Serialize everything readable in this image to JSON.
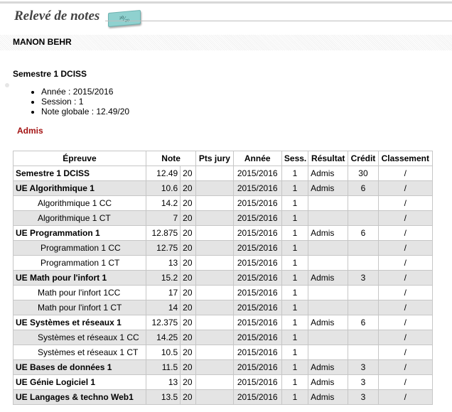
{
  "header": {
    "title": "Relevé de notes",
    "badge": "²⁰⁄₂₀"
  },
  "student": {
    "name": "MANON BEHR"
  },
  "semester": {
    "title": "Semestre 1 DCISS"
  },
  "info": [
    "Année : 2015/2016",
    "Session : 1",
    "Note globale : 12.49/20"
  ],
  "status": "Admis",
  "table": {
    "headers": [
      "Épreuve",
      "Note",
      "Pts jury",
      "Année",
      "Sess.",
      "Résultat",
      "Crédit",
      "Classement"
    ],
    "rows": [
      {
        "kind": "ue",
        "epreuve": "Semestre 1 DCISS",
        "note": "12.49",
        "sur": "20",
        "pts": "",
        "annee": "2015/2016",
        "sess": "1",
        "resultat": "Admis",
        "credit": "30",
        "classement": "/"
      },
      {
        "kind": "ue",
        "epreuve": "UE Algorithmique 1",
        "note": "10.6",
        "sur": "20",
        "pts": "",
        "annee": "2015/2016",
        "sess": "1",
        "resultat": "Admis",
        "credit": "6",
        "classement": "/"
      },
      {
        "kind": "sub",
        "epreuve": "Algorithmique 1 CC",
        "note": "14.2",
        "sur": "20",
        "pts": "",
        "annee": "2015/2016",
        "sess": "1",
        "resultat": "",
        "credit": "",
        "classement": "/"
      },
      {
        "kind": "sub",
        "epreuve": "Algorithmique 1 CT",
        "note": "7",
        "sur": "20",
        "pts": "",
        "annee": "2015/2016",
        "sess": "1",
        "resultat": "",
        "credit": "",
        "classement": "/"
      },
      {
        "kind": "ue",
        "epreuve": "UE Programmation 1",
        "note": "12.875",
        "sur": "20",
        "pts": "",
        "annee": "2015/2016",
        "sess": "1",
        "resultat": "Admis",
        "credit": "6",
        "classement": "/"
      },
      {
        "kind": "sub2",
        "epreuve": "Programmation 1 CC",
        "note": "12.75",
        "sur": "20",
        "pts": "",
        "annee": "2015/2016",
        "sess": "1",
        "resultat": "",
        "credit": "",
        "classement": "/"
      },
      {
        "kind": "sub2",
        "epreuve": "Programmation 1 CT",
        "note": "13",
        "sur": "20",
        "pts": "",
        "annee": "2015/2016",
        "sess": "1",
        "resultat": "",
        "credit": "",
        "classement": "/"
      },
      {
        "kind": "ue",
        "epreuve": "UE Math pour l'infort 1",
        "note": "15.2",
        "sur": "20",
        "pts": "",
        "annee": "2015/2016",
        "sess": "1",
        "resultat": "Admis",
        "credit": "3",
        "classement": "/"
      },
      {
        "kind": "sub",
        "epreuve": "Math pour l'infort 1CC",
        "note": "17",
        "sur": "20",
        "pts": "",
        "annee": "2015/2016",
        "sess": "1",
        "resultat": "",
        "credit": "",
        "classement": "/"
      },
      {
        "kind": "sub",
        "epreuve": "Math pour l'infort 1 CT",
        "note": "14",
        "sur": "20",
        "pts": "",
        "annee": "2015/2016",
        "sess": "1",
        "resultat": "",
        "credit": "",
        "classement": "/"
      },
      {
        "kind": "ue",
        "epreuve": "UE Systèmes et réseaux 1",
        "note": "12.375",
        "sur": "20",
        "pts": "",
        "annee": "2015/2016",
        "sess": "1",
        "resultat": "Admis",
        "credit": "6",
        "classement": "/"
      },
      {
        "kind": "sub",
        "epreuve": "Systèmes et réseaux 1 CC",
        "note": "14.25",
        "sur": "20",
        "pts": "",
        "annee": "2015/2016",
        "sess": "1",
        "resultat": "",
        "credit": "",
        "classement": "/"
      },
      {
        "kind": "sub",
        "epreuve": "Systèmes et réseaux 1 CT",
        "note": "10.5",
        "sur": "20",
        "pts": "",
        "annee": "2015/2016",
        "sess": "1",
        "resultat": "",
        "credit": "",
        "classement": "/"
      },
      {
        "kind": "ue",
        "epreuve": "UE Bases de données 1",
        "note": "11.5",
        "sur": "20",
        "pts": "",
        "annee": "2015/2016",
        "sess": "1",
        "resultat": "Admis",
        "credit": "3",
        "classement": "/"
      },
      {
        "kind": "ue",
        "epreuve": "UE Génie Logiciel 1",
        "note": "13",
        "sur": "20",
        "pts": "",
        "annee": "2015/2016",
        "sess": "1",
        "resultat": "Admis",
        "credit": "3",
        "classement": "/"
      },
      {
        "kind": "ue",
        "epreuve": "UE Langages & techno Web1",
        "note": "13.5",
        "sur": "20",
        "pts": "",
        "annee": "2015/2016",
        "sess": "1",
        "resultat": "Admis",
        "credit": "3",
        "classement": "/"
      }
    ]
  },
  "colors": {
    "status": "#a31212",
    "row_alt": "#e4e4e4",
    "badge": "#8fd1cf"
  }
}
